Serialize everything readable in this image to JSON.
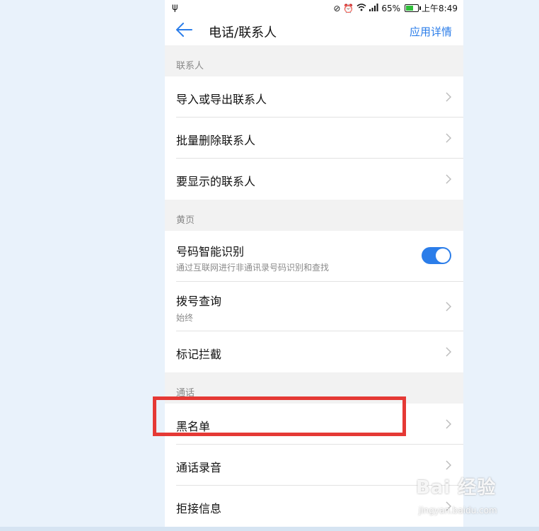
{
  "status_bar": {
    "usb_icon": "usb-icon",
    "icons": [
      "vibrate-off-icon",
      "alarm-icon",
      "wifi-icon",
      "signal-icon"
    ],
    "battery_percent": "65%",
    "battery_level": 0.65,
    "time": "上午8:49"
  },
  "header": {
    "back_icon": "back-arrow-icon",
    "title": "电话/联系人",
    "detail_link": "应用详情"
  },
  "sections": [
    {
      "title": "联系人",
      "items": [
        {
          "label": "导入或导出联系人",
          "sub": ""
        },
        {
          "label": "批量删除联系人",
          "sub": ""
        },
        {
          "label": "要显示的联系人",
          "sub": ""
        }
      ]
    },
    {
      "title": "黄页",
      "items": [
        {
          "label": "号码智能识别",
          "sub": "通过互联网进行非通讯录号码识别和查找",
          "toggle": true
        },
        {
          "label": "拨号查询",
          "sub": "始终"
        },
        {
          "label": "标记拦截",
          "sub": ""
        }
      ]
    },
    {
      "title": "通话",
      "items": [
        {
          "label": "黑名单",
          "sub": ""
        },
        {
          "label": "通话录音",
          "sub": ""
        },
        {
          "label": "拒接信息",
          "sub": ""
        }
      ]
    }
  ],
  "colors": {
    "accent": "#2b7de9",
    "highlight": "#e53935",
    "section_bg": "#f2f2f2"
  },
  "watermark": {
    "main": "Bai 经验",
    "sub": "jingyan.baidu.com"
  }
}
